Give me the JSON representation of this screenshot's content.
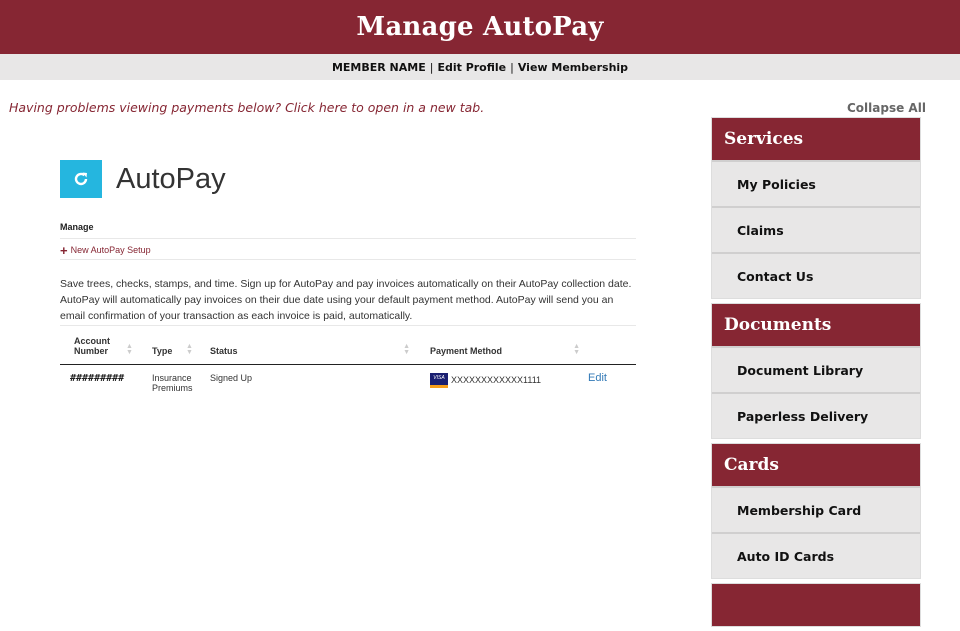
{
  "header": {
    "title": "Manage AutoPay"
  },
  "subnav": {
    "member_name": "MEMBER NAME",
    "edit_profile": "Edit Profile",
    "view_membership": "View Membership",
    "separator": "|"
  },
  "notice": {
    "text": "Having problems viewing payments below? Click here to open in a new tab."
  },
  "main": {
    "title": "AutoPay",
    "icon": "refresh-icon",
    "manage_label": "Manage",
    "new_setup_label": "New AutoPay Setup",
    "description": "Save trees, checks, stamps, and time. Sign up for AutoPay and pay invoices automatically on their AutoPay collection date. AutoPay will automatically pay invoices on their due date using your default payment method. AutoPay will send you an email confirmation of your transaction as each invoice is paid, automatically.",
    "table": {
      "columns": [
        "Account Number",
        "Type",
        "Status",
        "Payment Method",
        ""
      ],
      "rows": [
        {
          "account": "#########",
          "type": "Insurance Premiums",
          "status": "Signed Up",
          "card_brand": "VISA",
          "payment": "XXXXXXXXXXXX1111",
          "action": "Edit"
        }
      ]
    }
  },
  "sidebar": {
    "collapse_all": "Collapse All",
    "groups": [
      {
        "title": "Services",
        "items": [
          "My Policies",
          "Claims",
          "Contact Us"
        ]
      },
      {
        "title": "Documents",
        "items": [
          "Document Library",
          "Paperless Delivery"
        ]
      },
      {
        "title": "Cards",
        "items": [
          "Membership Card",
          "Auto ID Cards"
        ]
      }
    ]
  },
  "colors": {
    "brand": "#862633",
    "accent": "#25b6df",
    "link": "#337ab7",
    "panel": "#e8e7e7"
  }
}
